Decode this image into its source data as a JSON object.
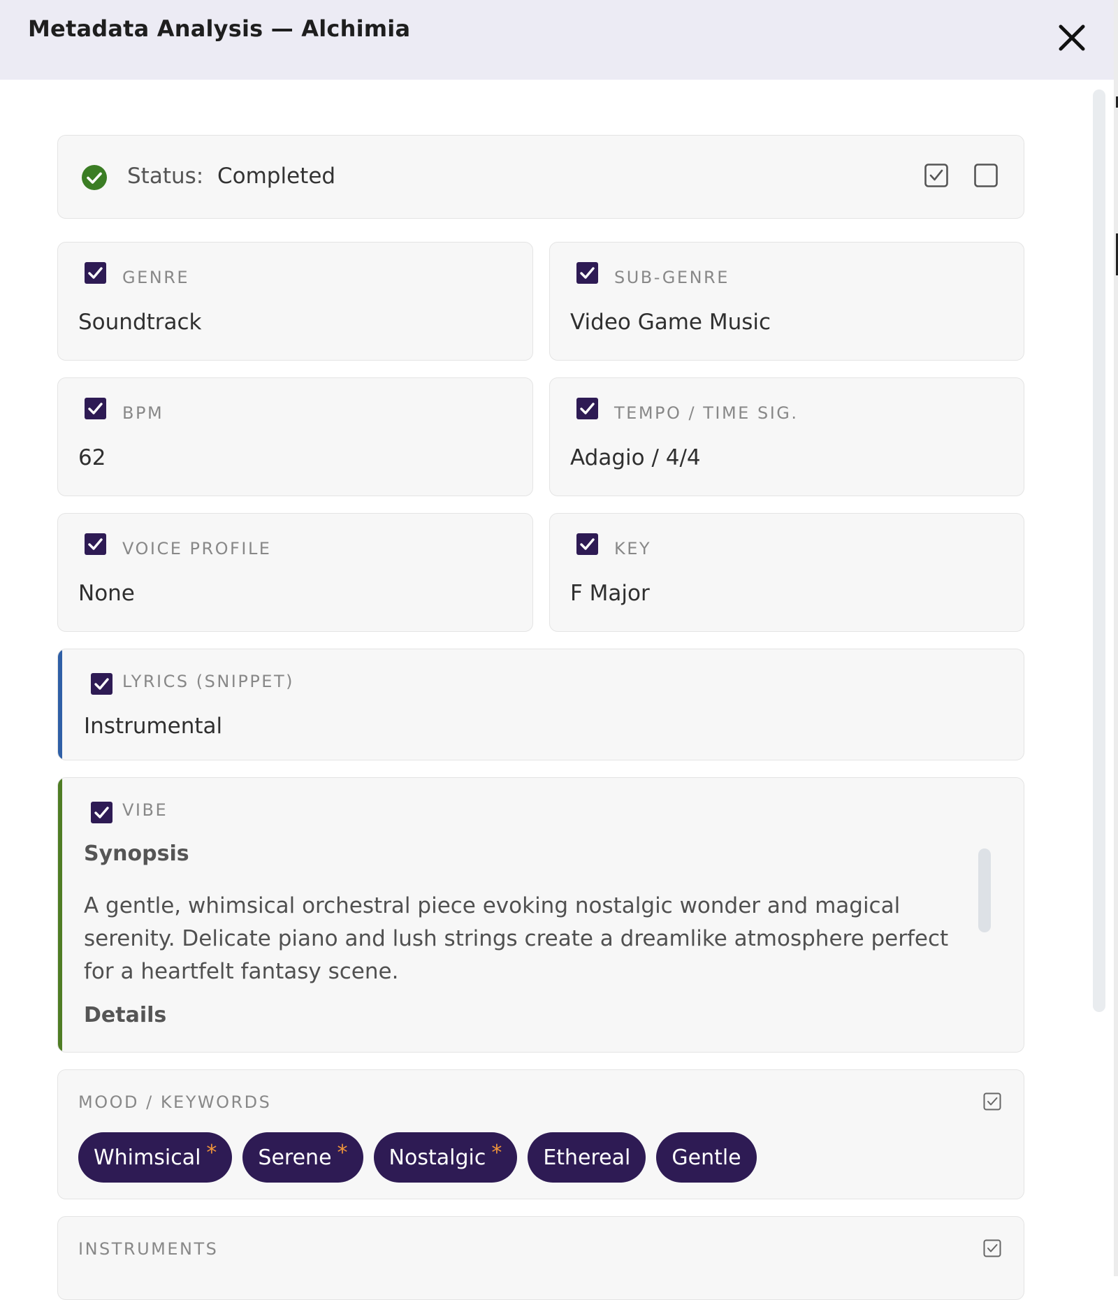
{
  "header": {
    "title": "Metadata Analysis — Alchimia"
  },
  "status": {
    "label": "Status:",
    "value": "Completed"
  },
  "fields": {
    "genre": {
      "label": "GENRE",
      "value": "Soundtrack",
      "checked": true
    },
    "sub_genre": {
      "label": "SUB-GENRE",
      "value": "Video Game Music",
      "checked": true
    },
    "bpm": {
      "label": "BPM",
      "value": "62",
      "checked": true
    },
    "tempo": {
      "label": "TEMPO / TIME SIG.",
      "value": "Adagio / 4/4",
      "checked": true
    },
    "voice_profile": {
      "label": "VOICE PROFILE",
      "value": "None",
      "checked": true
    },
    "key": {
      "label": "KEY",
      "value": "F Major",
      "checked": true
    }
  },
  "lyrics": {
    "label": "LYRICS (SNIPPET)",
    "value": "Instrumental",
    "checked": true
  },
  "vibe": {
    "label": "VIBE",
    "synopsis_heading": "Synopsis",
    "synopsis_text": "A gentle, whimsical orchestral piece evoking nostalgic wonder and magical serenity. Delicate piano and lush strings create a dreamlike atmosphere perfect for a heartfelt fantasy scene.",
    "details_heading": "Details",
    "checked": true
  },
  "mood": {
    "label": "MOOD / KEYWORDS",
    "tags": [
      {
        "text": "Whimsical",
        "starred": true
      },
      {
        "text": "Serene",
        "starred": true
      },
      {
        "text": "Nostalgic",
        "starred": true
      },
      {
        "text": "Ethereal",
        "starred": false
      },
      {
        "text": "Gentle",
        "starred": false
      }
    ]
  },
  "instruments": {
    "label": "INSTRUMENTS"
  },
  "colors": {
    "header_bg": "#ecebf4",
    "checkbox": "#2e1b54",
    "status_ok": "#3b7d24",
    "lyrics_accent": "#2f5fa6",
    "vibe_accent": "#4f7d24",
    "tag_bg": "#2e1b54",
    "tag_star": "#f0953a"
  },
  "icons": {
    "close": "close-icon",
    "status": "check-circle-icon",
    "approve": "checkbox-checked-icon",
    "reject": "checkbox-empty-icon"
  }
}
